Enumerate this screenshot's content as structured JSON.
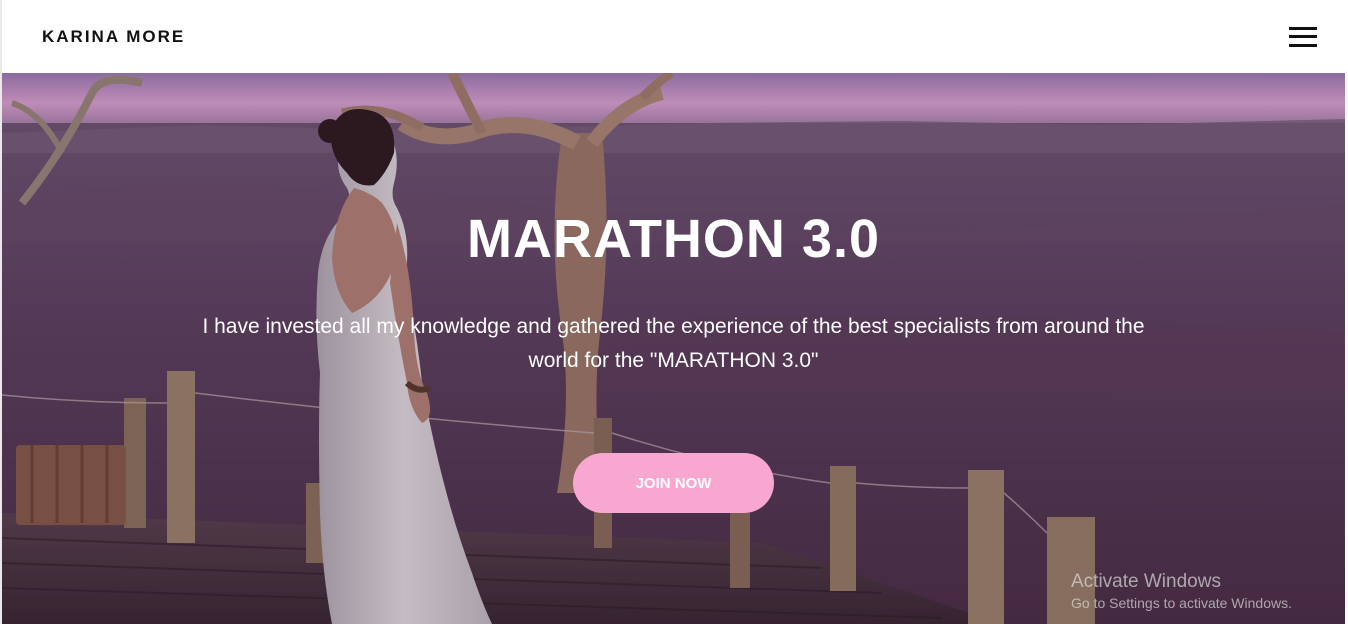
{
  "header": {
    "brand": "KARINA MORE",
    "menu_icon": "hamburger-menu-icon"
  },
  "hero": {
    "title": "MARATHON 3.0",
    "text": "I have invested all my knowledge and gathered the experience of the best specialists from around the world for the \"MARATHON 3.0\"",
    "button_label": "JOIN NOW",
    "button_color": "#f8a8d0"
  },
  "watermark": {
    "title": "Activate Windows",
    "subtitle": "Go to Settings to activate Windows."
  }
}
